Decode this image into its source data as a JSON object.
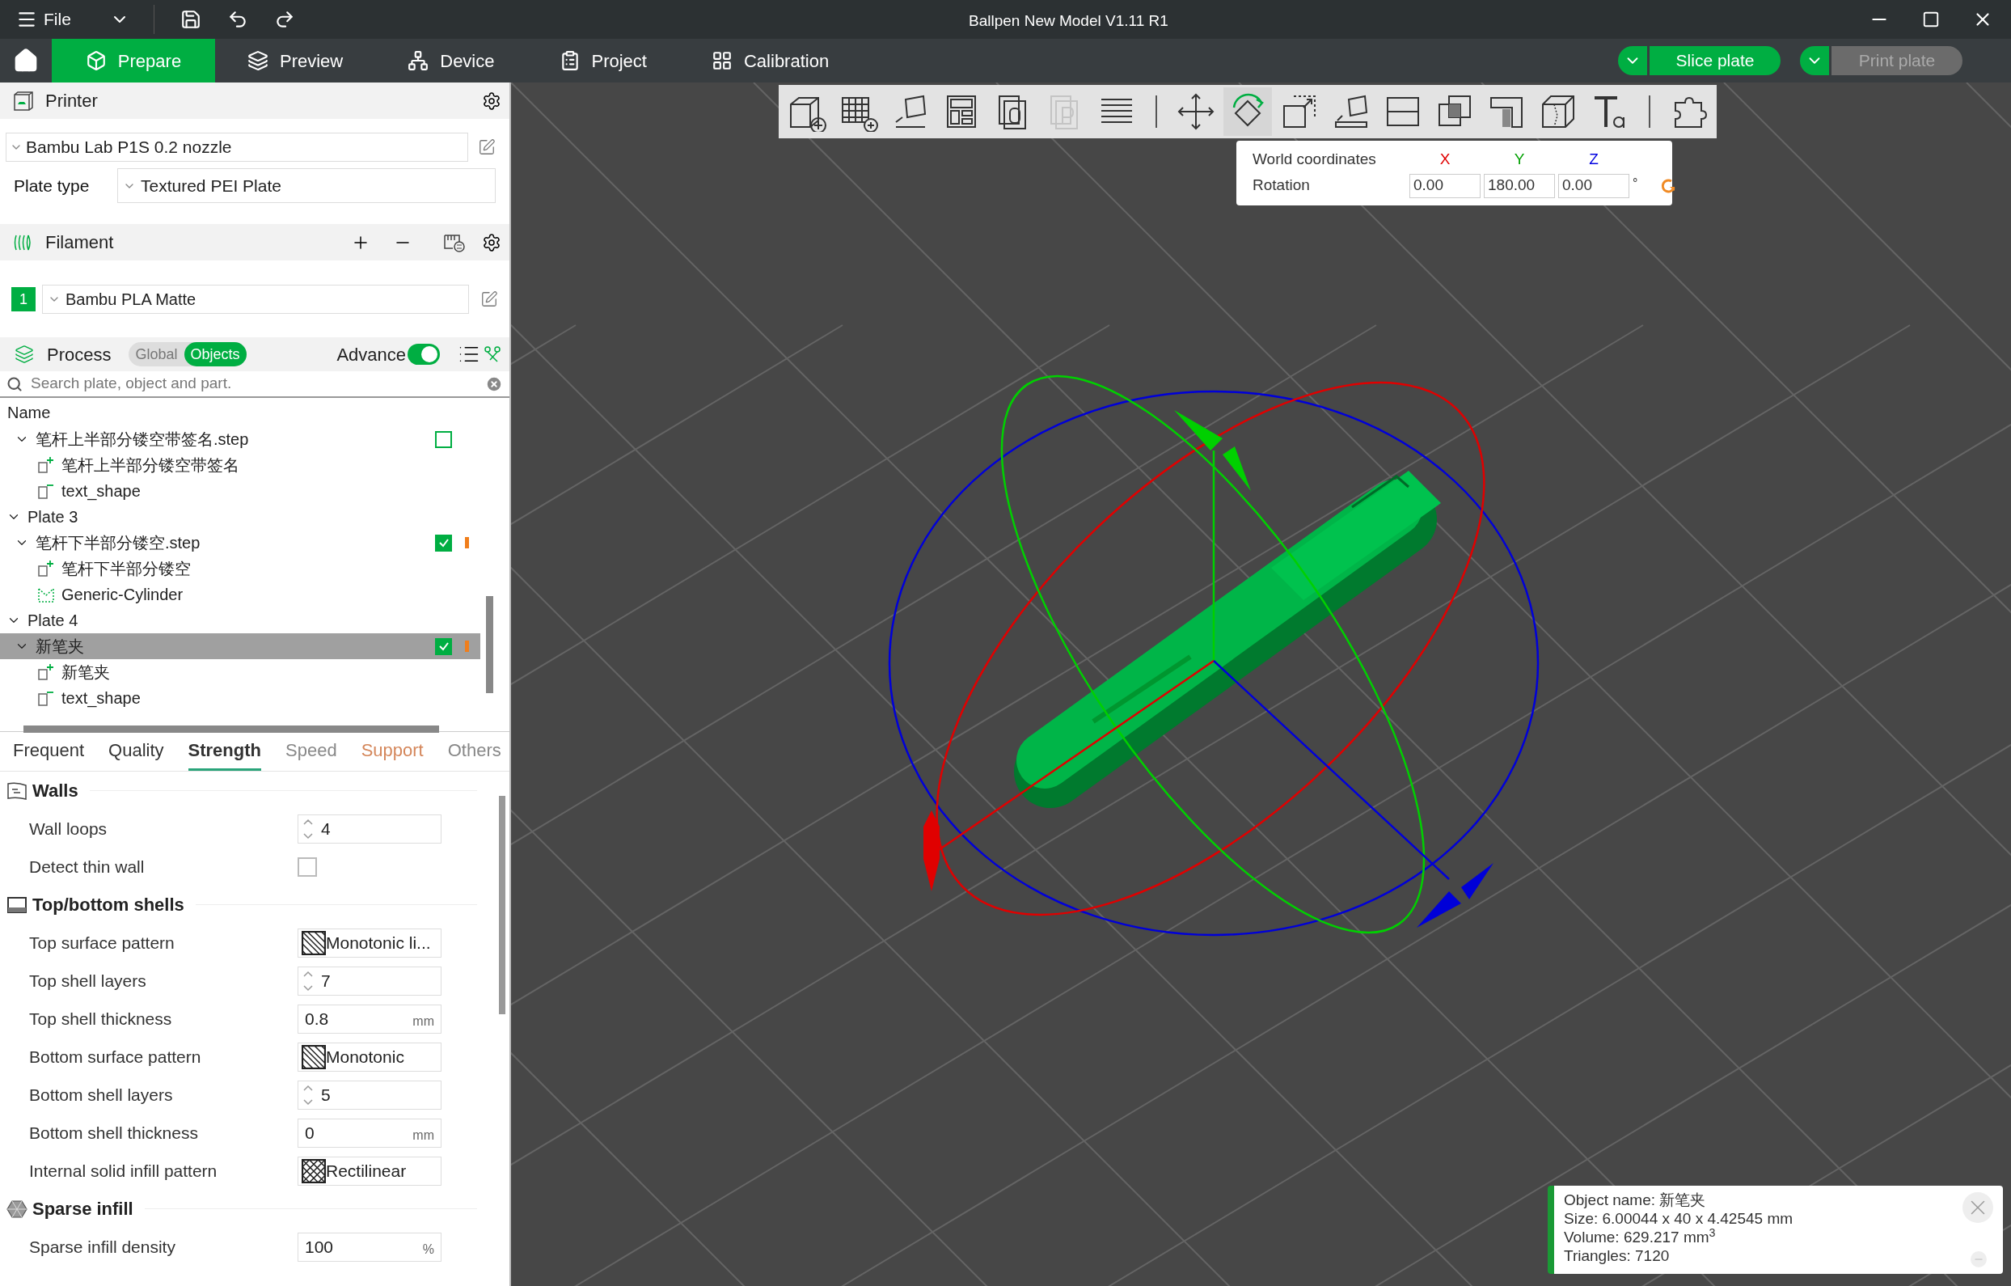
{
  "window": {
    "title": "Ballpen New Model V1.11 R1",
    "menu": "File"
  },
  "nav": {
    "tabs": [
      {
        "label": "Prepare",
        "kind": "prepare",
        "selected": true
      },
      {
        "label": "Preview",
        "kind": "preview",
        "selected": false
      },
      {
        "label": "Device",
        "kind": "device",
        "selected": false
      },
      {
        "label": "Project",
        "kind": "project",
        "selected": false
      },
      {
        "label": "Calibration",
        "kind": "calibration",
        "selected": false
      }
    ],
    "actions": [
      {
        "label": "Slice plate",
        "disabled": false
      },
      {
        "label": "Print plate",
        "disabled": true
      }
    ]
  },
  "printer": {
    "title": "Printer",
    "preset": "Bambu Lab P1S 0.2 nozzle",
    "plate_type_label": "Plate type",
    "plate_type": "Textured PEI Plate"
  },
  "filament": {
    "title": "Filament",
    "items": [
      {
        "number": "1",
        "name": "Bambu PLA Matte",
        "color": "#00ae42"
      }
    ]
  },
  "process": {
    "title": "Process",
    "modes": [
      {
        "label": "Global",
        "selected": false
      },
      {
        "label": "Objects",
        "selected": true
      }
    ],
    "advance_label": "Advance",
    "advance_on": true,
    "search_placeholder": "Search plate, object and part."
  },
  "object_list": {
    "column": "Name",
    "items": [
      {
        "label": "笔杆上半部分镂空带签名.step",
        "kind": "object",
        "expanded": true,
        "checked": false,
        "selected": false,
        "edited": false,
        "children": [
          {
            "label": "笔杆上半部分镂空带签名",
            "kind": "part"
          },
          {
            "label": "text_shape",
            "kind": "text"
          }
        ]
      },
      {
        "label": "Plate 3",
        "kind": "plate",
        "expanded": true,
        "children": [
          {
            "label": "笔杆下半部分镂空.step",
            "kind": "object",
            "expanded": true,
            "checked": true,
            "selected": false,
            "edited": true,
            "children": [
              {
                "label": "笔杆下半部分镂空",
                "kind": "part"
              },
              {
                "label": "Generic-Cylinder",
                "kind": "modifier"
              }
            ]
          }
        ]
      },
      {
        "label": "Plate 4",
        "kind": "plate",
        "expanded": true,
        "children": [
          {
            "label": "新笔夹",
            "kind": "object",
            "expanded": true,
            "checked": true,
            "selected": true,
            "edited": true,
            "children": [
              {
                "label": "新笔夹",
                "kind": "part"
              },
              {
                "label": "text_shape",
                "kind": "text"
              }
            ]
          }
        ]
      }
    ]
  },
  "settings": {
    "tabs": [
      {
        "label": "Frequent",
        "selected": false,
        "modified": false,
        "dimmed": false
      },
      {
        "label": "Quality",
        "selected": false,
        "modified": false,
        "dimmed": false
      },
      {
        "label": "Strength",
        "selected": true,
        "modified": false,
        "dimmed": false
      },
      {
        "label": "Speed",
        "selected": false,
        "modified": false,
        "dimmed": true
      },
      {
        "label": "Support",
        "selected": false,
        "modified": true,
        "dimmed": false
      },
      {
        "label": "Others",
        "selected": false,
        "modified": false,
        "dimmed": true
      }
    ],
    "groups": [
      {
        "title": "Walls",
        "kind": "walls",
        "options": [
          {
            "label": "Wall loops",
            "kind": "spin",
            "value": "4"
          },
          {
            "label": "Detect thin wall",
            "kind": "checkbox",
            "checked": false
          }
        ]
      },
      {
        "title": "Top/bottom shells",
        "kind": "shells",
        "options": [
          {
            "label": "Top surface pattern",
            "kind": "hatch",
            "value": "Monotonic li..."
          },
          {
            "label": "Top shell layers",
            "kind": "spin",
            "value": "7"
          },
          {
            "label": "Top shell thickness",
            "kind": "unit",
            "value": "0.8",
            "unit": "mm"
          },
          {
            "label": "Bottom surface pattern",
            "kind": "hatch",
            "value": "Monotonic"
          },
          {
            "label": "Bottom shell layers",
            "kind": "spin",
            "value": "5"
          },
          {
            "label": "Bottom shell thickness",
            "kind": "unit",
            "value": "0",
            "unit": "mm"
          },
          {
            "label": "Internal solid infill pattern",
            "kind": "crosshatch",
            "value": "Rectilinear"
          }
        ]
      },
      {
        "title": "Sparse infill",
        "kind": "infill",
        "options": [
          {
            "label": "Sparse infill density",
            "kind": "unit",
            "value": "100",
            "unit": "%"
          }
        ]
      }
    ]
  },
  "toolbar": {
    "groups": [
      [
        {
          "kind": "add",
          "selected": false,
          "disabled": false
        },
        {
          "kind": "plate",
          "selected": false,
          "disabled": false
        },
        {
          "kind": "orient",
          "selected": false,
          "disabled": false
        },
        {
          "kind": "arrange",
          "selected": false,
          "disabled": false
        },
        {
          "kind": "pages-o",
          "selected": false,
          "disabled": false
        },
        {
          "kind": "pages-p",
          "selected": false,
          "disabled": true
        },
        {
          "kind": "lines",
          "selected": false,
          "disabled": false
        }
      ],
      [
        {
          "kind": "move",
          "selected": false,
          "disabled": false
        },
        {
          "kind": "rotate",
          "selected": true,
          "disabled": false
        },
        {
          "kind": "scale",
          "selected": false,
          "disabled": false
        },
        {
          "kind": "lay",
          "selected": false,
          "disabled": false
        },
        {
          "kind": "cut",
          "selected": false,
          "disabled": false
        },
        {
          "kind": "boolean",
          "selected": false,
          "disabled": false
        },
        {
          "kind": "support",
          "selected": false,
          "disabled": false
        },
        {
          "kind": "seam",
          "selected": false,
          "disabled": false
        },
        {
          "kind": "text",
          "selected": false,
          "disabled": false
        }
      ],
      [
        {
          "kind": "assembly",
          "selected": false,
          "disabled": false
        }
      ]
    ]
  },
  "rotation_panel": {
    "heading": "World coordinates",
    "axes": [
      {
        "label": "X",
        "color": "#e00000"
      },
      {
        "label": "Y",
        "color": "#00a000"
      },
      {
        "label": "Z",
        "color": "#0000e0"
      }
    ],
    "label": "Rotation",
    "values": [
      "0.00",
      "180.00",
      "0.00"
    ],
    "unit": "°"
  },
  "object_info": {
    "lines": [
      "Object name: 新笔夹",
      "Size: 6.00044 x 40 x 4.42545 mm",
      "Volume: 629.217 mm$^{3}$",
      "Triangles: 7120"
    ]
  }
}
